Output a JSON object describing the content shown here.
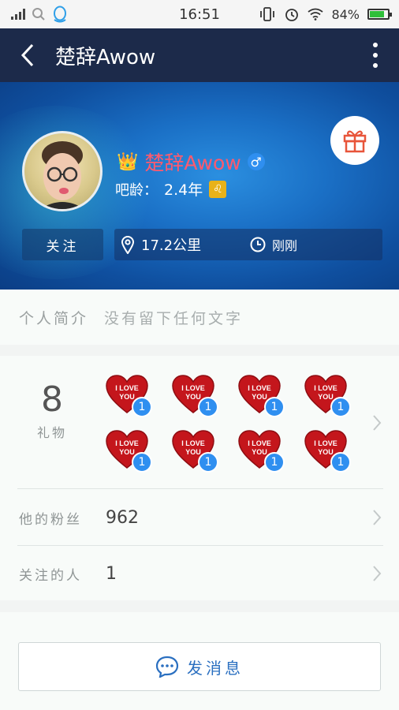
{
  "status_bar": {
    "time": "16:51",
    "battery_percent": "84%",
    "battery_level": 0.84,
    "icons": [
      "signal-icon",
      "search-icon",
      "qq-icon",
      "vibrate-icon",
      "alarm-icon",
      "wifi-icon",
      "battery-icon"
    ]
  },
  "nav": {
    "title": "楚辞Awow",
    "back_icon": "chevron-left-icon",
    "menu_icon": "more-vertical-icon"
  },
  "profile": {
    "username": "楚辞Awow",
    "crown_icon": "crown-icon",
    "gender_symbol": "♂",
    "age_label": "吧龄：",
    "age_value": "2.4年",
    "zodiac_symbol": "♌",
    "follow_label": "关注",
    "distance": "17.2公里",
    "last_seen": "刚刚",
    "gift_icon": "gift-icon",
    "colors": {
      "username": "#ff5a6e",
      "gender_badge": "#2f8ff0",
      "zodiac_badge": "#e8b21a"
    }
  },
  "intro": {
    "label": "个人简介",
    "text": "没有留下任何文字"
  },
  "gifts": {
    "count": "8",
    "label": "礼物",
    "items": [
      {
        "text": "I LOVE YOU",
        "badge": "1"
      },
      {
        "text": "I LOVE YOU",
        "badge": "1"
      },
      {
        "text": "I LOVE YOU",
        "badge": "1"
      },
      {
        "text": "I LOVE YOU",
        "badge": "1"
      },
      {
        "text": "I LOVE YOU",
        "badge": "1"
      },
      {
        "text": "I LOVE YOU",
        "badge": "1"
      },
      {
        "text": "I LOVE YOU",
        "badge": "1"
      },
      {
        "text": "I LOVE YOU",
        "badge": "1"
      }
    ]
  },
  "followers": {
    "label": "他的粉丝",
    "value": "962"
  },
  "following": {
    "label": "关注的人",
    "value": "1"
  },
  "send_message": {
    "label": "发消息",
    "icon": "chat-bubble-icon"
  }
}
